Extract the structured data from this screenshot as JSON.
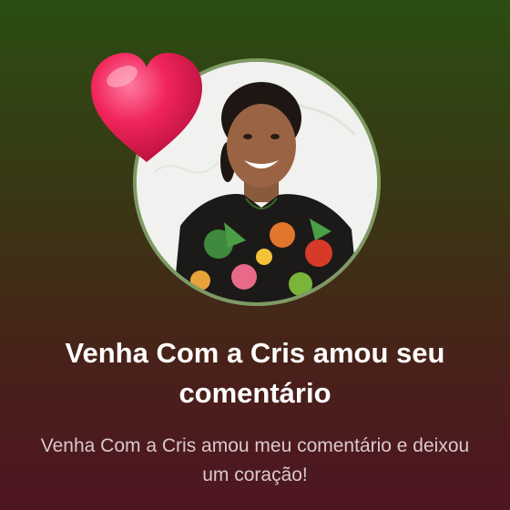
{
  "notification": {
    "title": "Venha Com a Cris amou seu comentário",
    "message": "Venha Com a Cris amou meu comentário e deixou um coração!",
    "avatar_icon": "profile-photo",
    "reaction_icon": "heart-icon"
  },
  "colors": {
    "background_top": "#2a4d12",
    "background_bottom": "#4e1622",
    "avatar_ring": "#7d9a63",
    "heart": "#e8194f",
    "title_text": "#ffffff",
    "message_text": "#d8c9cc"
  }
}
